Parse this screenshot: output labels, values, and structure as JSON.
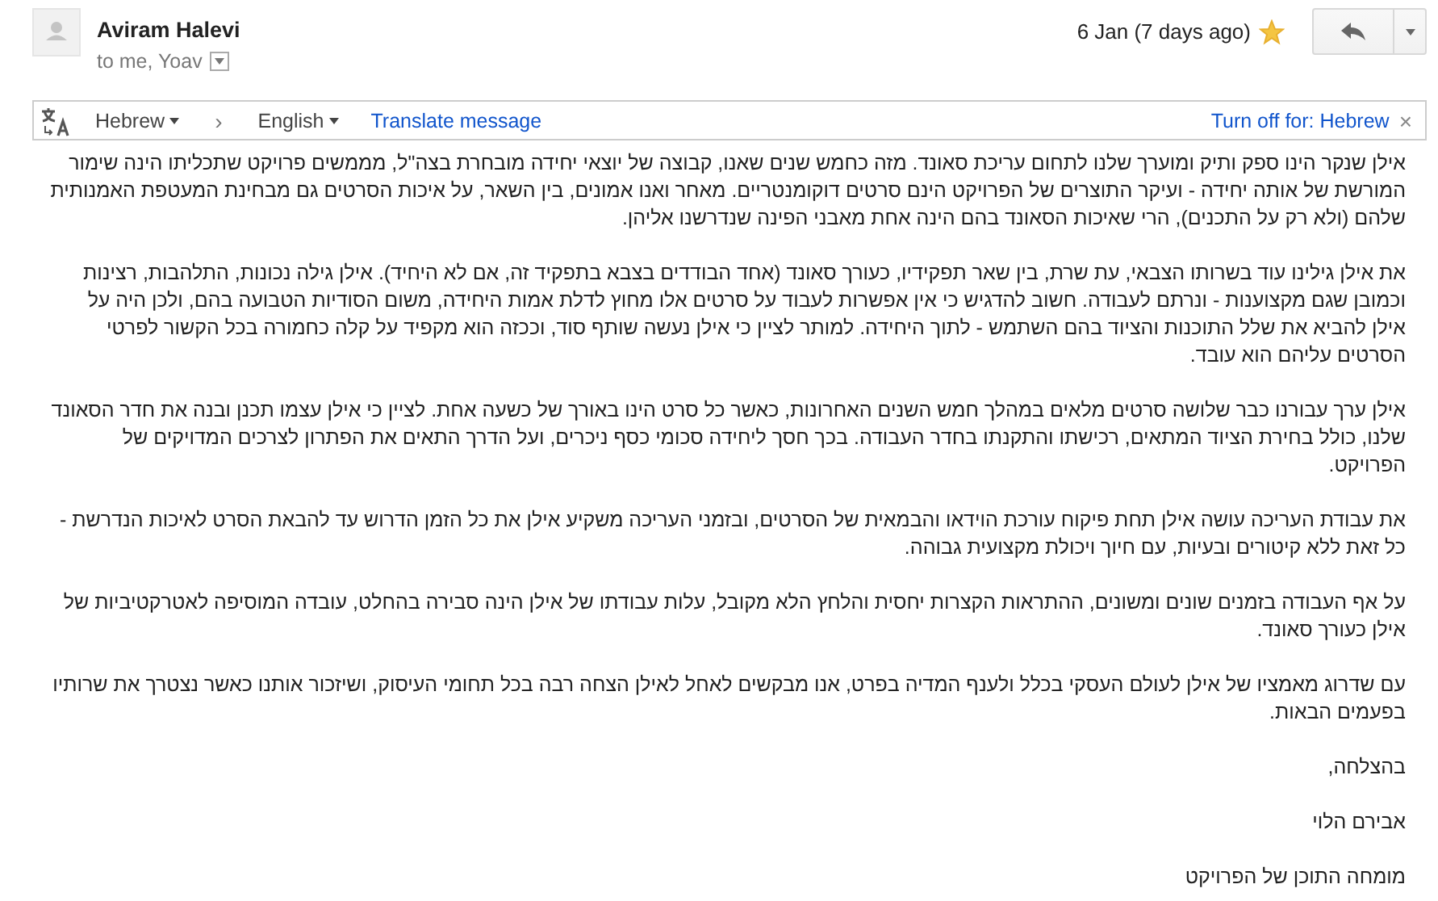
{
  "message": {
    "sender": "Aviram Halevi",
    "recipients": "to me, Yoav",
    "date": "6 Jan (7 days ago)",
    "starred": true
  },
  "translate_bar": {
    "source_language": "Hebrew",
    "separator": "›",
    "target_language": "English",
    "translate_link": "Translate message",
    "turn_off_link": "Turn off for: Hebrew",
    "close": "×"
  },
  "body": {
    "paragraphs": [
      "אילן שנקר הינו ספק ותיק ומוערך שלנו לתחום עריכת סאונד. מזה כחמש שנים שאנו, קבוצה של יוצאי יחידה מובחרת בצה\"ל, מממשים פרויקט שתכליתו הינה שימור המורשת של אותה יחידה - ועיקר התוצרים של הפרויקט הינם סרטים דוקומנטריים. מאחר ואנו אמונים, בין השאר, על איכות הסרטים גם מבחינת המעטפת האמנותית שלהם (ולא רק על התכנים), הרי שאיכות הסאונד בהם הינה אחת מאבני הפינה שנדרשנו אליהן.",
      "את אילן גילינו עוד בשרותו הצבאי, עת שרת, בין שאר תפקידיו, כעורך סאונד (אחד הבודדים בצבא בתפקיד זה, אם לא היחיד). אילן גילה נכונות, התלהבות, רצינות וכמובן שגם מקצוענות - ונרתם לעבודה. חשוב להדגיש כי אין אפשרות לעבוד על סרטים אלו מחוץ לדלת אמות היחידה, משום הסודיות הטבועה בהם, ולכן היה על אילן להביא את שלל התוכנות והציוד בהם השתמש - לתוך היחידה. למותר לציין כי אילן נעשה שותף סוד, וככזה הוא מקפיד על קלה כחמורה בכל הקשור לפרטי הסרטים עליהם הוא עובד.",
      "אילן ערך עבורנו כבר שלושה סרטים מלאים במהלך חמש השנים האחרונות, כאשר כל סרט הינו באורך של כשעה אחת. לציין כי אילן עצמו תכנן ובנה את חדר הסאונד שלנו, כולל בחירת הציוד המתאים, רכישתו והתקנתו בחדר העבודה. בכך חסך ליחידה סכומי כסף ניכרים, ועל הדרך התאים את הפתרון לצרכים המדויקים של הפרויקט.",
      "את עבודת העריכה עושה אילן תחת פיקוח עורכת הוידאו והבמאית של הסרטים, ובזמני העריכה משקיע אילן את כל הזמן הדרוש עד להבאת הסרט לאיכות הנדרשת - כל זאת ללא קיטורים ובעיות, עם חיוך ויכולת מקצועית גבוהה.",
      "על אף העבודה בזמנים שונים ומשונים, ההתראות הקצרות יחסית והלחץ הלא מקובל, עלות עבודתו של אילן הינה סבירה בהחלט, עובדה המוסיפה לאטרקטיביות של אילן כעורך סאונד.",
      "עם שדרוג מאמציו של אילן לעולם העסקי בכלל ולענף המדיה בפרט, אנו מבקשים לאחל לאילן הצחה רבה בכל תחומי העיסוק, ושיזכור אותנו כאשר נצטרך את שרותיו בפעמים הבאות.",
      "בהצלחה,",
      "אבירם הלוי",
      "מומחה התוכן של הפרויקט"
    ]
  }
}
